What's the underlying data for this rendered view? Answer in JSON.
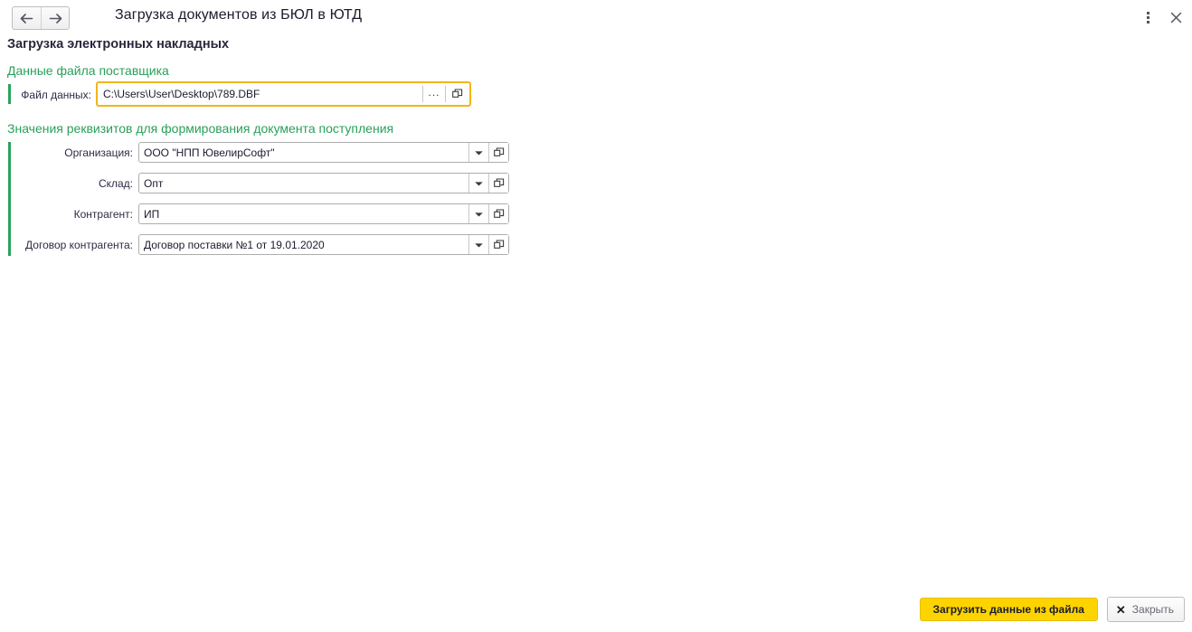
{
  "window": {
    "title": "Загрузка документов из БЮЛ в ЮТД",
    "back_icon": "arrow-left-icon",
    "forward_icon": "arrow-right-icon",
    "menu_icon": "kebab-menu-icon",
    "close_icon": "close-icon"
  },
  "page": {
    "subtitle": "Загрузка электронных накладных"
  },
  "groups": {
    "supplier": {
      "heading": "Данные файла поставщика",
      "field": {
        "label": "Файл данных:",
        "value": "C:\\Users\\User\\Desktop\\789.DBF",
        "browse_label": "...",
        "open_icon": "open-window-icon",
        "focused": true
      }
    },
    "attributes": {
      "heading": "Значения реквизитов для формирования документа поступления",
      "fields": [
        {
          "label": "Организация:",
          "value": "ООО \"НПП ЮвелирСофт\"",
          "dropdown_icon": "chevron-down-icon",
          "open_icon": "open-window-icon"
        },
        {
          "label": "Склад:",
          "value": "Опт",
          "dropdown_icon": "chevron-down-icon",
          "open_icon": "open-window-icon"
        },
        {
          "label": "Контрагент:",
          "value": "ИП",
          "dropdown_icon": "chevron-down-icon",
          "open_icon": "open-window-icon"
        },
        {
          "label": "Договор контрагента:",
          "value": "Договор поставки №1 от 19.01.2020",
          "dropdown_icon": "chevron-down-icon",
          "open_icon": "open-window-icon"
        }
      ]
    }
  },
  "footer": {
    "primary_label": "Загрузить данные из файла",
    "close_label": "Закрыть",
    "close_icon": "x-icon"
  },
  "colors": {
    "accent_green": "#2aa35c",
    "heading_green": "#29a05a",
    "focus_yellow": "#f0b619",
    "primary_yellow": "#fdd400",
    "text_dark": "#1b1b2e"
  }
}
